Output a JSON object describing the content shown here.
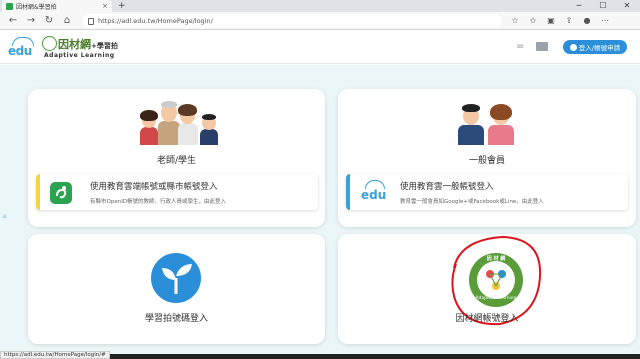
{
  "browser": {
    "tab_title": "因材網&學習拍",
    "tab_close": "×",
    "new_tab": "+",
    "url": "https://adl.edu.tw/HomePage/login/",
    "minimize": "─",
    "maximize": "☐",
    "close": "✕"
  },
  "header": {
    "edu_logo_text": "edu",
    "brand_title": "因材網",
    "brand_plus": "+學習拍",
    "brand_sub": "Adaptive Learning",
    "menu_glyph": "=",
    "login_button": "登入/帳號申請"
  },
  "cards": {
    "teacher_student": {
      "title": "老師/學生",
      "option_title": "使用教育雲端帳號或縣市帳號登入",
      "option_desc": "有縣市OpenID帳號的教師、行政人員或學生，由此登入"
    },
    "general": {
      "title": "一般會員",
      "option_title": "使用教育雲一般帳號登入",
      "option_desc": "教育雲一般會員如Google+或Facebook或Line，由此登入",
      "edu_logo_text": "edu"
    },
    "xuexipai": {
      "title": "學習拍號碼登入"
    },
    "adl": {
      "title": "因材網帳號登入",
      "logo_top": "因 材 網",
      "logo_bottom": "Adaptive Learning"
    }
  },
  "status_bar": {
    "url": "https://adl.edu.tw/HomePage/login/#"
  },
  "colors": {
    "accent_blue": "#2a8fd8",
    "brand_green": "#4a9c3a",
    "yellow_bar": "#f5d73a",
    "blue_bar": "#3aa0d8",
    "annotation_red": "#d9141c",
    "page_bg": "#eaf6f7"
  }
}
